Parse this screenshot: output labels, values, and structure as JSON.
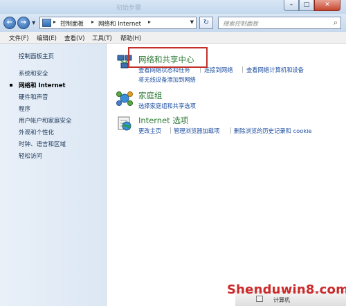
{
  "titlebar": {
    "faded_title": "初始步骤",
    "minimize": "–",
    "maximize": "□",
    "close": "✕"
  },
  "nav": {
    "back": "←",
    "forward": "→",
    "dropdown": "▼",
    "crumbs": [
      "控制面板",
      "网络和 Internet"
    ],
    "crumb_sep": "▸",
    "refresh": "↻",
    "search_placeholder": "搜索控制面板",
    "search_icon": "⌕"
  },
  "menu": [
    "文件(F)",
    "编辑(E)",
    "查看(V)",
    "工具(T)",
    "帮助(H)"
  ],
  "sidebar": {
    "items": [
      "控制面板主页",
      "系统和安全",
      "网络和 Internet",
      "硬件和声音",
      "程序",
      "用户帐户和家庭安全",
      "外观和个性化",
      "时钟、语言和区域",
      "轻松访问"
    ],
    "active": 2
  },
  "categories": [
    {
      "title": "网络和共享中心",
      "icon": "network-icon",
      "links": [
        "查看网络状态和任务",
        "连接到网络",
        "查看网络计算机和设备",
        "将无线设备添加到网络"
      ]
    },
    {
      "title": "家庭组",
      "icon": "homegroup-icon",
      "links": [
        "选择家庭组和共享选项"
      ]
    },
    {
      "title": "Internet 选项",
      "icon": "internet-options-icon",
      "links": [
        "更改主页",
        "管理浏览器加载项",
        "删除浏览的历史记录和 cookie"
      ]
    }
  ],
  "status": {
    "text": "计算机"
  },
  "watermark": "Shenduwin8.com",
  "colors": {
    "category_title": "#2f7b37",
    "task_link": "#1e4fa0",
    "highlight_box": "#c2302a"
  }
}
